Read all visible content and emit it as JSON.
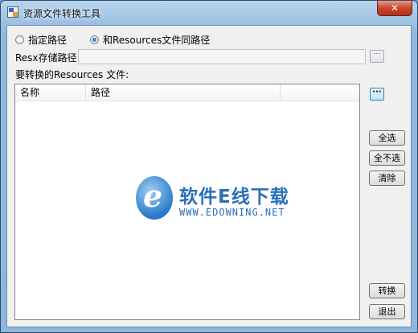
{
  "window": {
    "title": "资源文件转换工具",
    "close_label": "✕"
  },
  "options": {
    "radio_specified": "指定路径",
    "radio_same": "和Resources文件同路径",
    "selected": "same"
  },
  "resx": {
    "label": "Resx存储路径:",
    "value": "",
    "browse_label": "···"
  },
  "files": {
    "label": "要转换的Resources 文件:",
    "browse_label": "···",
    "columns": [
      "名称",
      "路径"
    ],
    "rows": []
  },
  "buttons": {
    "select_all": "全选",
    "select_none": "全不选",
    "clear": "清除",
    "convert": "转换",
    "exit": "退出"
  },
  "watermark": {
    "brand": "软件E线下载",
    "url": "WWW.EDOWNING.NET"
  }
}
